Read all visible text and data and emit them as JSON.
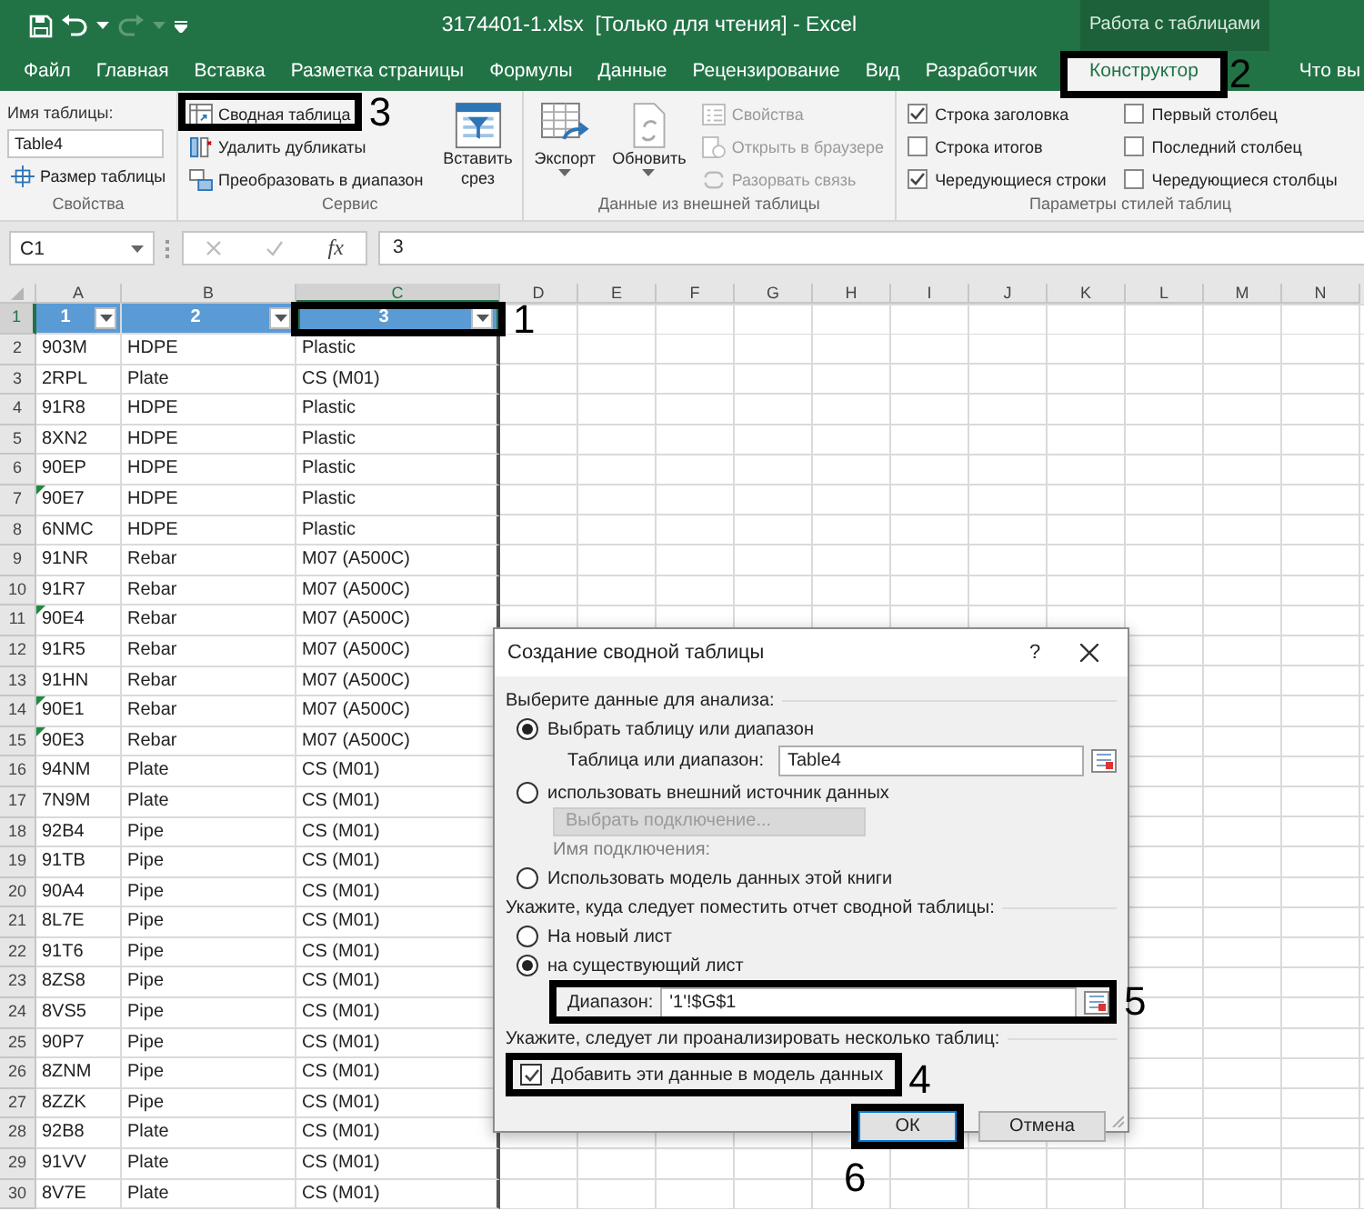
{
  "window": {
    "title": "3174401-1.xlsx  [Только для чтения] - Excel",
    "context_tab_group": "Работа с таблицами"
  },
  "tabs": [
    {
      "label": "Файл",
      "selected": false
    },
    {
      "label": "Главная",
      "selected": false
    },
    {
      "label": "Вставка",
      "selected": false
    },
    {
      "label": "Разметка страницы",
      "selected": false
    },
    {
      "label": "Формулы",
      "selected": false
    },
    {
      "label": "Данные",
      "selected": false
    },
    {
      "label": "Рецензирование",
      "selected": false
    },
    {
      "label": "Вид",
      "selected": false
    },
    {
      "label": "Разработчик",
      "selected": false
    },
    {
      "label": "Конструктор",
      "selected": true
    }
  ],
  "tell_me": "Что вы",
  "ribbon": {
    "properties": {
      "label": "Свойства",
      "field_label": "Имя таблицы:",
      "field_value": "Table4",
      "resize_button": "Размер таблицы"
    },
    "tools": {
      "label": "Сервис",
      "buttons": [
        {
          "label": "Сводная таблица"
        },
        {
          "label": "Удалить дубликаты"
        },
        {
          "label": "Преобразовать в диапазон"
        }
      ],
      "slicer_button": "Вставить срез"
    },
    "external_data": {
      "label": "Данные из внешней таблицы",
      "large_buttons": [
        {
          "label": "Экспорт"
        },
        {
          "label": "Обновить"
        }
      ],
      "buttons": [
        {
          "label": "Свойства",
          "disabled": true
        },
        {
          "label": "Открыть в браузере",
          "disabled": true
        },
        {
          "label": "Разорвать связь",
          "disabled": true
        }
      ]
    },
    "style_options": {
      "label": "Параметры стилей таблиц",
      "options": [
        {
          "label": "Строка заголовка",
          "checked": true
        },
        {
          "label": "Строка итогов",
          "checked": false
        },
        {
          "label": "Чередующиеся строки",
          "checked": true
        },
        {
          "label": "Первый столбец",
          "checked": false
        },
        {
          "label": "Последний столбец",
          "checked": false
        },
        {
          "label": "Чередующиеся столбцы",
          "checked": false
        }
      ]
    }
  },
  "formula_bar": {
    "name_box": "C1",
    "function_label": "fx",
    "value": "3"
  },
  "sheet": {
    "columns": [
      {
        "label": "A",
        "selected": false
      },
      {
        "label": "B",
        "selected": false
      },
      {
        "label": "C",
        "selected": true
      },
      {
        "label": "D",
        "selected": false
      },
      {
        "label": "E",
        "selected": false
      },
      {
        "label": "F",
        "selected": false
      },
      {
        "label": "G",
        "selected": false
      },
      {
        "label": "H",
        "selected": false
      },
      {
        "label": "I",
        "selected": false
      },
      {
        "label": "J",
        "selected": false
      },
      {
        "label": "K",
        "selected": false
      },
      {
        "label": "L",
        "selected": false
      },
      {
        "label": "M",
        "selected": false
      },
      {
        "label": "N",
        "selected": false
      }
    ],
    "header_row": {
      "number": "1",
      "selected": true,
      "cells": [
        {
          "text": "1",
          "selected": false
        },
        {
          "text": "2",
          "selected": false
        },
        {
          "text": "3",
          "selected": true
        }
      ]
    },
    "rows": [
      {
        "number": "2",
        "cells": [
          "903M",
          "HDPE",
          "Plastic"
        ],
        "flag": false
      },
      {
        "number": "3",
        "cells": [
          "2RPL",
          "Plate",
          "CS (M01)"
        ],
        "flag": false
      },
      {
        "number": "4",
        "cells": [
          "91R8",
          "HDPE",
          "Plastic"
        ],
        "flag": false
      },
      {
        "number": "5",
        "cells": [
          "8XN2",
          "HDPE",
          "Plastic"
        ],
        "flag": false
      },
      {
        "number": "6",
        "cells": [
          "90EP",
          "HDPE",
          "Plastic"
        ],
        "flag": false
      },
      {
        "number": "7",
        "cells": [
          "90E7",
          "HDPE",
          "Plastic"
        ],
        "flag": true
      },
      {
        "number": "8",
        "cells": [
          "6NMC",
          "HDPE",
          "Plastic"
        ],
        "flag": false
      },
      {
        "number": "9",
        "cells": [
          "91NR",
          "Rebar",
          "M07 (A500C)"
        ],
        "flag": false
      },
      {
        "number": "10",
        "cells": [
          "91R7",
          "Rebar",
          "M07 (A500C)"
        ],
        "flag": false
      },
      {
        "number": "11",
        "cells": [
          "90E4",
          "Rebar",
          "M07 (A500C)"
        ],
        "flag": true
      },
      {
        "number": "12",
        "cells": [
          "91R5",
          "Rebar",
          "M07 (A500C)"
        ],
        "flag": false
      },
      {
        "number": "13",
        "cells": [
          "91HN",
          "Rebar",
          "M07 (A500C)"
        ],
        "flag": false
      },
      {
        "number": "14",
        "cells": [
          "90E1",
          "Rebar",
          "M07 (A500C)"
        ],
        "flag": true
      },
      {
        "number": "15",
        "cells": [
          "90E3",
          "Rebar",
          "M07 (A500C)"
        ],
        "flag": true
      },
      {
        "number": "16",
        "cells": [
          "94NM",
          "Plate",
          "CS (M01)"
        ],
        "flag": false
      },
      {
        "number": "17",
        "cells": [
          "7N9M",
          "Plate",
          "CS (M01)"
        ],
        "flag": false
      },
      {
        "number": "18",
        "cells": [
          "92B4",
          "Pipe",
          "CS (M01)"
        ],
        "flag": false
      },
      {
        "number": "19",
        "cells": [
          "91TB",
          "Pipe",
          "CS (M01)"
        ],
        "flag": false
      },
      {
        "number": "20",
        "cells": [
          "90A4",
          "Pipe",
          "CS (M01)"
        ],
        "flag": false
      },
      {
        "number": "21",
        "cells": [
          "8L7E",
          "Pipe",
          "CS (M01)"
        ],
        "flag": false
      },
      {
        "number": "22",
        "cells": [
          "91T6",
          "Pipe",
          "CS (M01)"
        ],
        "flag": false
      },
      {
        "number": "23",
        "cells": [
          "8ZS8",
          "Pipe",
          "CS (M01)"
        ],
        "flag": false
      },
      {
        "number": "24",
        "cells": [
          "8VS5",
          "Pipe",
          "CS (M01)"
        ],
        "flag": false
      },
      {
        "number": "25",
        "cells": [
          "90P7",
          "Pipe",
          "CS (M01)"
        ],
        "flag": false
      },
      {
        "number": "26",
        "cells": [
          "8ZNM",
          "Pipe",
          "CS (M01)"
        ],
        "flag": false
      },
      {
        "number": "27",
        "cells": [
          "8ZZK",
          "Pipe",
          "CS (M01)"
        ],
        "flag": false
      },
      {
        "number": "28",
        "cells": [
          "92B8",
          "Plate",
          "CS (M01)"
        ],
        "flag": false
      },
      {
        "number": "29",
        "cells": [
          "91VV",
          "Plate",
          "CS (M01)"
        ],
        "flag": false
      },
      {
        "number": "30",
        "cells": [
          "8V7E",
          "Plate",
          "CS (M01)"
        ],
        "flag": false
      }
    ]
  },
  "dialog": {
    "title": "Создание сводной таблицы",
    "help_button": "?",
    "source_heading": "Выберите данные для анализа:",
    "source_options": [
      {
        "label": "Выбрать таблицу или диапазон",
        "selected": true
      },
      {
        "label": "использовать внешний источник данных",
        "selected": false
      },
      {
        "label": "Использовать модель данных этой книги",
        "selected": false
      }
    ],
    "table_range": {
      "label": "Таблица или диапазон:",
      "value": "Table4"
    },
    "connection_button": {
      "label": "Выбрать подключение...",
      "disabled": true
    },
    "connection_name": {
      "label": "Имя подключения:",
      "disabled": true
    },
    "destination_heading": "Укажите, куда следует поместить отчет сводной таблицы:",
    "destination_options": [
      {
        "label": "На новый лист",
        "selected": false
      },
      {
        "label": "на существующий лист",
        "selected": true
      }
    ],
    "location": {
      "label": "Диапазон:",
      "value": "'1'!$G$1"
    },
    "multiple_heading": "Укажите, следует ли проанализировать несколько таблиц:",
    "add_to_model": {
      "label": "Добавить эти данные в модель данных",
      "checked": true
    },
    "buttons": [
      {
        "label": "ОК",
        "kind": "primary"
      },
      {
        "label": "Отмена",
        "kind": "secondary"
      }
    ]
  },
  "annotations": [
    {
      "label": "1"
    },
    {
      "label": "2"
    },
    {
      "label": "3"
    },
    {
      "label": "4"
    },
    {
      "label": "5"
    },
    {
      "label": "6"
    }
  ]
}
